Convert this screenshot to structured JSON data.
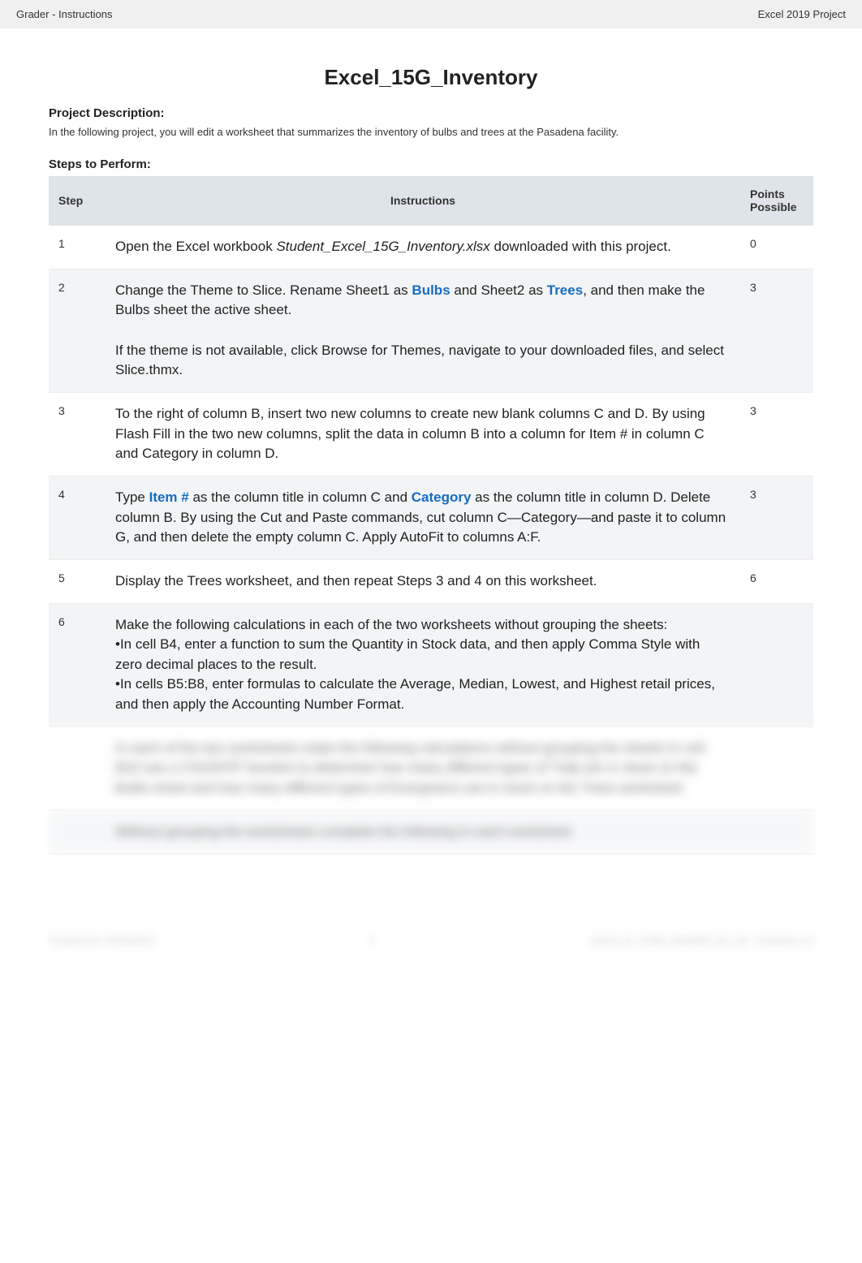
{
  "header": {
    "left": "Grader - Instructions",
    "right": "Excel 2019 Project"
  },
  "title": "Excel_15G_Inventory",
  "project_label": "Project Description:",
  "project_description": "In the following project, you will edit a worksheet that summarizes the inventory of bulbs and trees at the Pasadena facility.",
  "steps_label": "Steps to Perform:",
  "table_headers": {
    "step": "Step",
    "instructions": "Instructions",
    "points": "Points Possible"
  },
  "rows": [
    {
      "step": "1",
      "points": "0",
      "parts": [
        {
          "t": "Open the Excel workbook ",
          "cls": ""
        },
        {
          "t": "Student_Excel_15G_Inventory.xlsx",
          "cls": "italic"
        },
        {
          "t": " downloaded with this project.",
          "cls": ""
        }
      ]
    },
    {
      "step": "2",
      "points": "3",
      "parts": [
        {
          "t": "Change the Theme to Slice. Rename Sheet1 as ",
          "cls": ""
        },
        {
          "t": "Bulbs",
          "cls": "boldblue"
        },
        {
          "t": " and Sheet2 as ",
          "cls": ""
        },
        {
          "t": "Trees",
          "cls": "boldblue"
        },
        {
          "t": ", and then make the Bulbs sheet the active sheet.",
          "cls": ""
        },
        {
          "t": "\n\n",
          "cls": ""
        },
        {
          "t": "If the theme is not available, click Browse for Themes, navigate to your downloaded files, and select Slice.thmx.",
          "cls": ""
        }
      ]
    },
    {
      "step": "3",
      "points": "3",
      "parts": [
        {
          "t": "To the right of column B, insert two new columns to create new blank columns C and D. By using Flash Fill in the two new columns, split the data in column B into a column for Item # in column C and Category in column D.",
          "cls": ""
        }
      ]
    },
    {
      "step": "4",
      "points": "3",
      "parts": [
        {
          "t": "Type ",
          "cls": ""
        },
        {
          "t": "Item #",
          "cls": "boldblue"
        },
        {
          "t": " as the column title in column C and ",
          "cls": ""
        },
        {
          "t": "Category",
          "cls": "boldblue"
        },
        {
          "t": " as the column title in column D. Delete column B. By using the Cut and Paste commands, cut column C—Category—and paste it to column G, and then delete the empty column C. Apply AutoFit to columns A:F.",
          "cls": ""
        }
      ]
    },
    {
      "step": "5",
      "points": "6",
      "parts": [
        {
          "t": "Display the Trees worksheet, and then repeat Steps 3 and 4 on this worksheet.",
          "cls": ""
        }
      ]
    },
    {
      "step": "6",
      "points": "",
      "parts": [
        {
          "t": "Make the following calculations in each of the two worksheets without grouping the sheets:\n•In cell B4, enter a function to sum the Quantity in Stock data, and then apply Comma Style with zero decimal places to the result.\n•In cells B5:B8, enter formulas to calculate the Average, Median, Lowest, and Highest retail prices, and then apply the Accounting Number Format.",
          "cls": ""
        }
      ]
    }
  ],
  "blur_rows": [
    {
      "step": "",
      "points": "",
      "text": "In each of the two worksheets make the following calculations without grouping the sheets In cell B10 use a COUNTIF function to determine how many different types of Tulip are in stock on the Bulbs sheet and how many different types of Evergreens are in stock on the Trees worksheet"
    },
    {
      "step": "",
      "points": "",
      "text": "Without grouping the worksheets complete the following in each worksheet"
    }
  ],
  "footer": {
    "left": "Created On: 07/05/2019",
    "center": "1",
    "right": "GO19_XL_CH05_GRADER_5G_AS - Inventory 1.0"
  }
}
